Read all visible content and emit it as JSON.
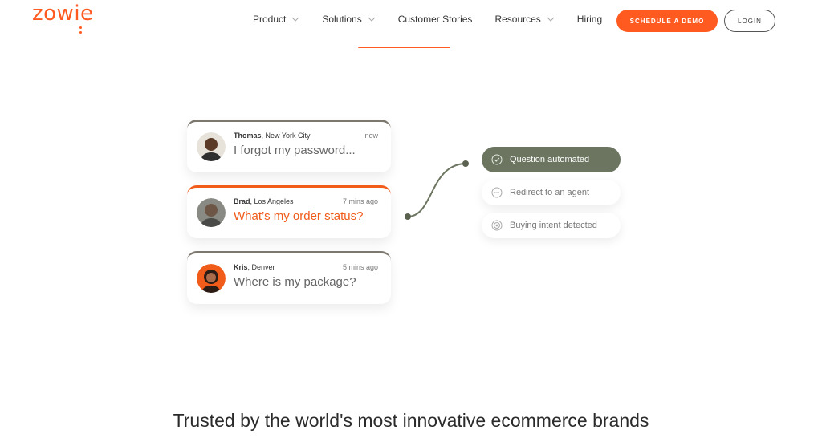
{
  "brand": {
    "logo_text": "zowie",
    "accent_color": "#ff5a1f",
    "secondary_color": "#6b7560"
  },
  "nav": {
    "items": [
      {
        "label": "Product",
        "has_dropdown": true
      },
      {
        "label": "Solutions",
        "has_dropdown": true
      },
      {
        "label": "Customer Stories",
        "has_dropdown": false
      },
      {
        "label": "Resources",
        "has_dropdown": true
      },
      {
        "label": "Hiring",
        "has_dropdown": false
      }
    ],
    "demo_button": "SCHEDULE A DEMO",
    "login_button": "LOGIN"
  },
  "conversations": [
    {
      "name": "Thomas",
      "location": ", New York City",
      "time": "now",
      "message": "I forgot my password...",
      "active": false
    },
    {
      "name": "Brad",
      "location": ", Los Angeles",
      "time": "7 mins ago",
      "message": "What’s my order status?",
      "active": true
    },
    {
      "name": "Kris",
      "location": ", Denver",
      "time": "5 mins ago",
      "message": "Where is my package?",
      "active": false
    }
  ],
  "outcomes": [
    {
      "label": "Question automated",
      "icon": "check-circle-icon",
      "selected": true
    },
    {
      "label": "Redirect to an agent",
      "icon": "chat-bubble-icon",
      "selected": false
    },
    {
      "label": "Buying intent detected",
      "icon": "target-icon",
      "selected": false
    }
  ],
  "trusted_heading": "Trusted by the world's most innovative ecommerce brands"
}
